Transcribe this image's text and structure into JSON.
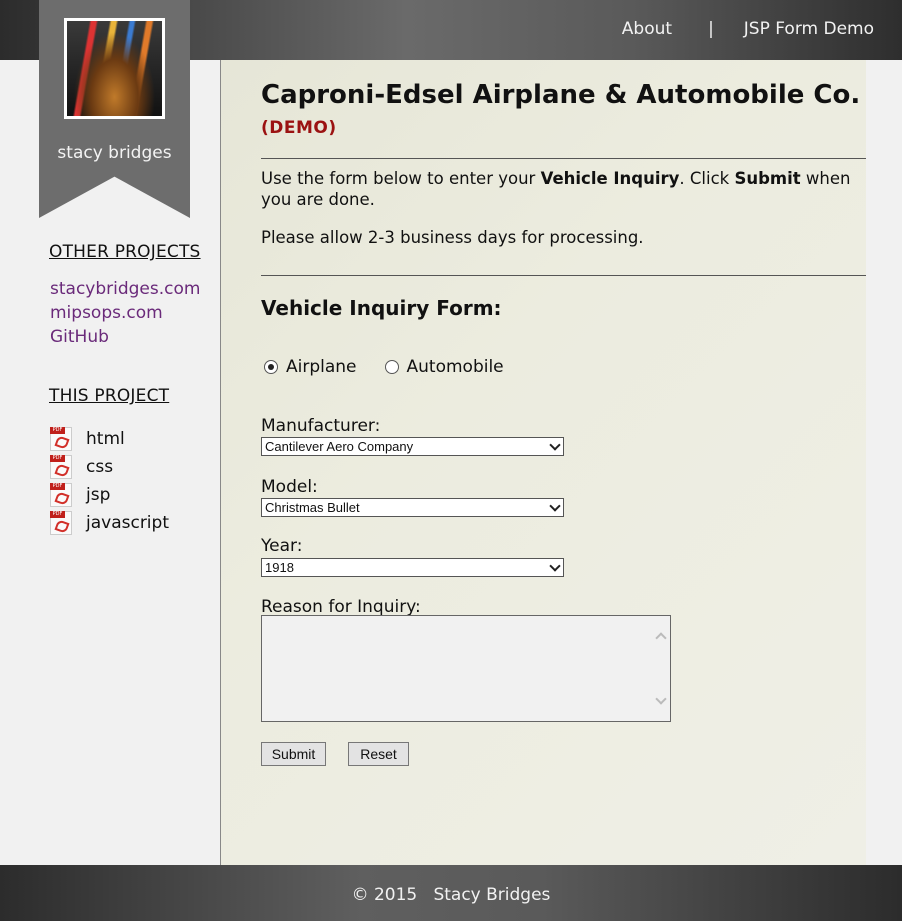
{
  "nav": {
    "about": "About",
    "separator": "|",
    "jsp_form_demo": "JSP Form Demo"
  },
  "profile": {
    "name": "stacy bridges"
  },
  "sidebar": {
    "other_projects_heading": "OTHER PROJECTS",
    "other_projects": [
      "stacybridges.com",
      "mipsops.com",
      "GitHub"
    ],
    "this_project_heading": "THIS PROJECT",
    "files": [
      {
        "label": "html",
        "icon": "pdf-icon"
      },
      {
        "label": "css",
        "icon": "pdf-icon"
      },
      {
        "label": "jsp",
        "icon": "pdf-icon"
      },
      {
        "label": "javascript",
        "icon": "pdf-icon"
      }
    ]
  },
  "main": {
    "title": "Caproni-Edsel Airplane & Automobile Co.",
    "demo": "(DEMO)",
    "intro_part1": "Use the form below to enter your ",
    "intro_bold1": "Vehicle Inquiry",
    "intro_part2": ". Click ",
    "intro_bold2": "Submit",
    "intro_part3": " when you are done.",
    "note": "Please allow 2-3 business days for processing.",
    "form_title": "Vehicle Inquiry Form:"
  },
  "form": {
    "radio_airplane": "Airplane",
    "radio_automobile": "Automobile",
    "selected_type": "Airplane",
    "manufacturer_label": "Manufacturer:",
    "manufacturer_value": "Cantilever Aero Company",
    "model_label": "Model:",
    "model_value": "Christmas Bullet",
    "year_label": "Year:",
    "year_value": "1918",
    "reason_label": "Reason for Inquiry:",
    "reason_value": "",
    "submit": "Submit",
    "reset": "Reset"
  },
  "footer": {
    "copyright": "© 2015   Stacy Bridges"
  },
  "colors": {
    "link_purple": "#6a2a7a",
    "demo_red": "#9b1212",
    "ribbon_gray": "#6d6d6d",
    "main_bg": "#ececdf"
  }
}
